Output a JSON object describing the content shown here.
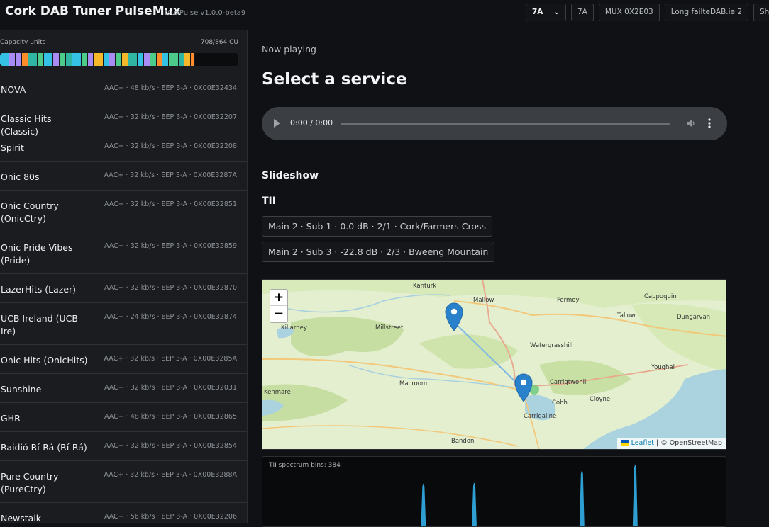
{
  "header": {
    "title": "Cork DAB Tuner PulseMux",
    "version": "MuxPulse v1.0.0-beta9",
    "channel_select": "7A",
    "chips": [
      "7A",
      "MUX 0X2E03",
      "Long failteDAB.ie 2",
      "Sh"
    ]
  },
  "capacity": {
    "label": "Capacity units",
    "value": "708/864 CU",
    "fill_fraction": 0.819,
    "segments": [
      {
        "color": "#35c1e4",
        "units": 36
      },
      {
        "color": "#a98bf4",
        "units": 24
      },
      {
        "color": "#a98bf4",
        "units": 24
      },
      {
        "color": "#ff8c2a",
        "units": 24
      },
      {
        "color": "#2fb5a1",
        "units": 36
      },
      {
        "color": "#4ccb8a",
        "units": 24
      },
      {
        "color": "#35c1e4",
        "units": 36
      },
      {
        "color": "#a98bf4",
        "units": 24
      },
      {
        "color": "#4ccb8a",
        "units": 24
      },
      {
        "color": "#2fb5a1",
        "units": 24
      },
      {
        "color": "#35c1e4",
        "units": 36
      },
      {
        "color": "#4ccb8a",
        "units": 24
      },
      {
        "color": "#a98bf4",
        "units": 24
      },
      {
        "color": "#f6b82b",
        "units": 36
      },
      {
        "color": "#35c1e4",
        "units": 24
      },
      {
        "color": "#a98bf4",
        "units": 24
      },
      {
        "color": "#4ccb8a",
        "units": 24
      },
      {
        "color": "#f6b82b",
        "units": 24
      },
      {
        "color": "#2fb5a1",
        "units": 36
      },
      {
        "color": "#35c1e4",
        "units": 24
      },
      {
        "color": "#a98bf4",
        "units": 24
      },
      {
        "color": "#4ccb8a",
        "units": 24
      },
      {
        "color": "#ff8c2a",
        "units": 24
      },
      {
        "color": "#35c1e4",
        "units": 24
      },
      {
        "color": "#4ccb8a",
        "units": 36
      },
      {
        "color": "#2fb5a1",
        "units": 24
      },
      {
        "color": "#f6b82b",
        "units": 24
      },
      {
        "color": "#ff8c2a",
        "units": 16
      }
    ]
  },
  "services": [
    {
      "name": "NOVA",
      "info": "AAC+ · 48 kb/s · EEP 3-A · 0X00E32434"
    },
    {
      "name": "Classic Hits (Classic)",
      "info": "AAC+ · 32 kb/s · EEP 3-A · 0X00E32207"
    },
    {
      "name": "Spirit",
      "info": "AAC+ · 32 kb/s · EEP 3-A · 0X00E32208"
    },
    {
      "name": "Onic 80s",
      "info": "AAC+ · 32 kb/s · EEP 3-A · 0X00E3287A"
    },
    {
      "name": "Onic Country (OnicCtry)",
      "info": "AAC+ · 32 kb/s · EEP 3-A · 0X00E32851"
    },
    {
      "name": "Onic Pride Vibes (Pride)",
      "info": "AAC+ · 32 kb/s · EEP 3-A · 0X00E32859"
    },
    {
      "name": "LazerHits (Lazer)",
      "info": "AAC+ · 32 kb/s · EEP 3-A · 0X00E32870"
    },
    {
      "name": "UCB Ireland (UCB Ire)",
      "info": "AAC+ · 24 kb/s · EEP 3-A · 0X00E32874"
    },
    {
      "name": "Onic Hits (OnicHits)",
      "info": "AAC+ · 32 kb/s · EEP 3-A · 0X00E3285A"
    },
    {
      "name": "Sunshine",
      "info": "AAC+ · 32 kb/s · EEP 3-A · 0X00E32031"
    },
    {
      "name": "GHR",
      "info": "AAC+ · 48 kb/s · EEP 3-A · 0X00E32865"
    },
    {
      "name": "Raidió Rí-Rá (Rí-Rá)",
      "info": "AAC+ · 32 kb/s · EEP 3-A · 0X00E32854"
    },
    {
      "name": "Pure Country (PureCtry)",
      "info": "AAC+ · 32 kb/s · EEP 3-A · 0X00E3288A"
    },
    {
      "name": "Newstalk",
      "info": "AAC+ · 56 kb/s · EEP 3-A · 0X00E32206"
    }
  ],
  "main": {
    "now_playing": "Now playing",
    "service_title": "Select a service",
    "player_time": "0:00 / 0:00",
    "slideshow_heading": "Slideshow",
    "tii_heading": "TII",
    "tii_entries": [
      "Main 2 · Sub 1 · 0.0 dB · 2/1 · Cork/Farmers Cross",
      "Main 2 · Sub 3 · -22.8 dB · 2/3 · Bweeng Mountain"
    ],
    "map": {
      "zoom_in": "+",
      "zoom_out": "−",
      "attribution_link": "Leaflet",
      "attribution_sep": " | ",
      "attribution_source": "© OpenStreetMap",
      "places": [
        "Kanturk",
        "Mallow",
        "Fermoy",
        "Cappoquin",
        "Killarney",
        "Millstreet",
        "Tallow",
        "Dungarvan",
        "Watergrasshill",
        "Youghal",
        "Macroom",
        "Carrigtwohill",
        "Kenmare",
        "Cloyne",
        "Cobh",
        "Carrigaline",
        "Bandon"
      ]
    },
    "spectrum": {
      "label": "TII spectrum bins: 384",
      "bins": 384,
      "line_color": "#2f9fd3",
      "peaks": [
        {
          "bin": 133,
          "level": 0.62
        },
        {
          "bin": 175,
          "level": 0.63
        },
        {
          "bin": 264,
          "level": 0.8
        },
        {
          "bin": 308,
          "level": 0.88
        }
      ]
    }
  }
}
